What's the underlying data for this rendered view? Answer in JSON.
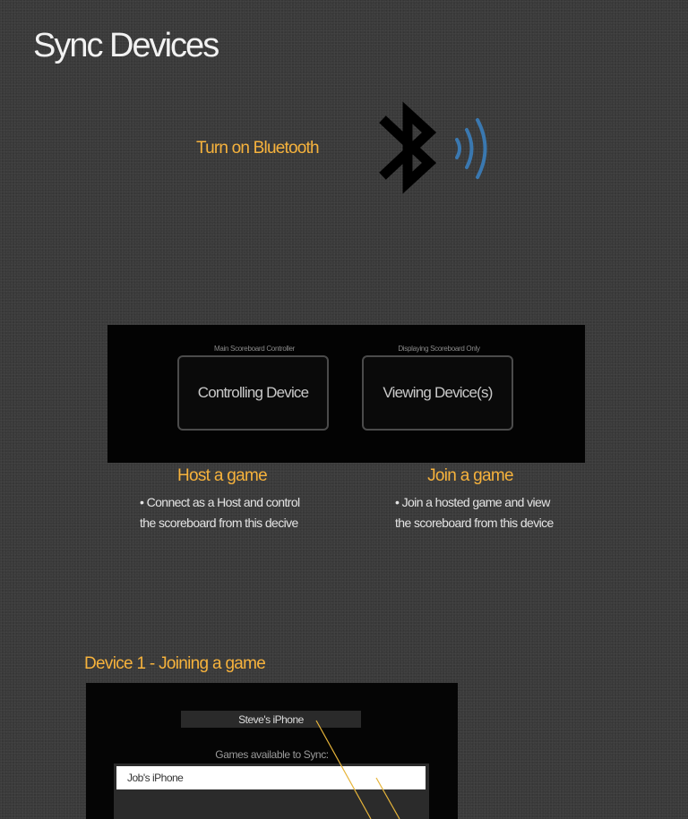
{
  "page": {
    "title": "Sync Devices"
  },
  "bluetooth": {
    "label": "Turn on Bluetooth",
    "icon": "bluetooth-icon",
    "wave_color": "#3a78b0"
  },
  "device_panel": {
    "controller": {
      "caption": "Main Scoreboard Controller",
      "button_label": "Controlling Device"
    },
    "viewer": {
      "caption": "Displaying Scoreboard Only",
      "button_label": "Viewing Device(s)"
    }
  },
  "host": {
    "title": "Host a game",
    "line1": "• Connect as a Host and control",
    "line2": "the scoreboard from this decive"
  },
  "join": {
    "title": "Join a game",
    "line1": "• Join a hosted game and view",
    "line2": "the scoreboard from this device"
  },
  "joining": {
    "title": "Device 1 - Joining a game",
    "device_name": "Steve's iPhone",
    "games_label": "Games available to Sync:",
    "games": [
      "Job's iPhone"
    ]
  },
  "colors": {
    "accent": "#f6b23c",
    "background": "#3a3a3a",
    "panel": "#030303",
    "annotation_line": "#e6b43a"
  }
}
